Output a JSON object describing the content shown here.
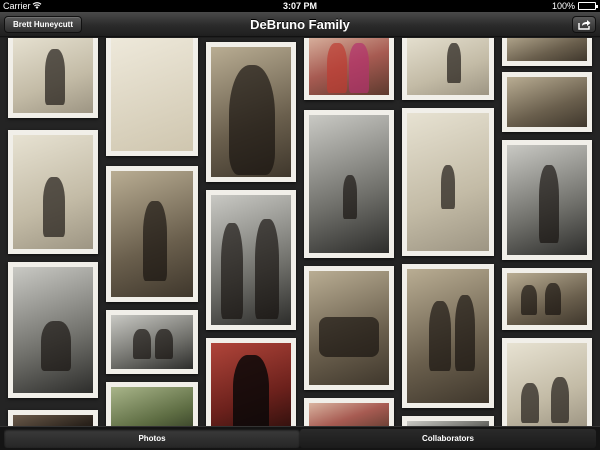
{
  "status_bar": {
    "carrier": "Carrier",
    "time": "3:07 PM",
    "battery": "100%"
  },
  "nav": {
    "back_label": "Brett Huneycutt",
    "title": "DeBruno Family",
    "share_icon": "share-icon"
  },
  "tabs": [
    {
      "label": "Photos",
      "selected": true
    },
    {
      "label": "Collaborators",
      "selected": false
    }
  ],
  "colors": {
    "nav_bar": "#2b2b2b",
    "background": "#242424",
    "photo_border": "#f1efe9"
  }
}
